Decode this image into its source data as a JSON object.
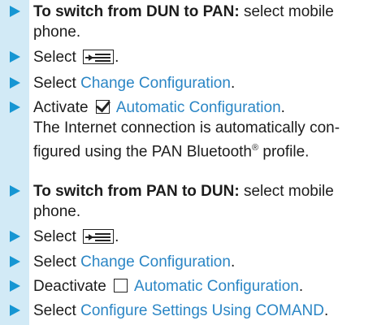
{
  "steps": [
    {
      "bold": "To switch from DUN to PAN:",
      "text": " select mobile phone."
    },
    {
      "prefix": "Select ",
      "icon": "menu-button-icon",
      "suffix": "."
    },
    {
      "prefix": "Select ",
      "link": "Change Configuration",
      "suffix": "."
    },
    {
      "prefix": "Activate ",
      "icon": "checkbox-checked-icon",
      "link": "Automatic Configuration",
      "suffix": ".",
      "note_pre": "The Internet connection is automatically con-figured using the PAN Bluetooth",
      "note_sup": "®",
      "note_post": " profile."
    },
    {
      "bold": "To switch from PAN to DUN:",
      "text": " select mobile phone."
    },
    {
      "prefix": "Select ",
      "icon": "menu-button-icon",
      "suffix": "."
    },
    {
      "prefix": "Select ",
      "link": "Change Configuration",
      "suffix": "."
    },
    {
      "prefix": "Deactivate ",
      "icon": "checkbox-empty-icon",
      "link": "Automatic Configuration",
      "suffix": "."
    },
    {
      "prefix": "Select ",
      "link": "Configure Settings Using COMAND",
      "suffix": "."
    }
  ],
  "colors": {
    "arrow": "#1696d3",
    "bar": "#d2eaf6",
    "link": "#2b86c5"
  }
}
